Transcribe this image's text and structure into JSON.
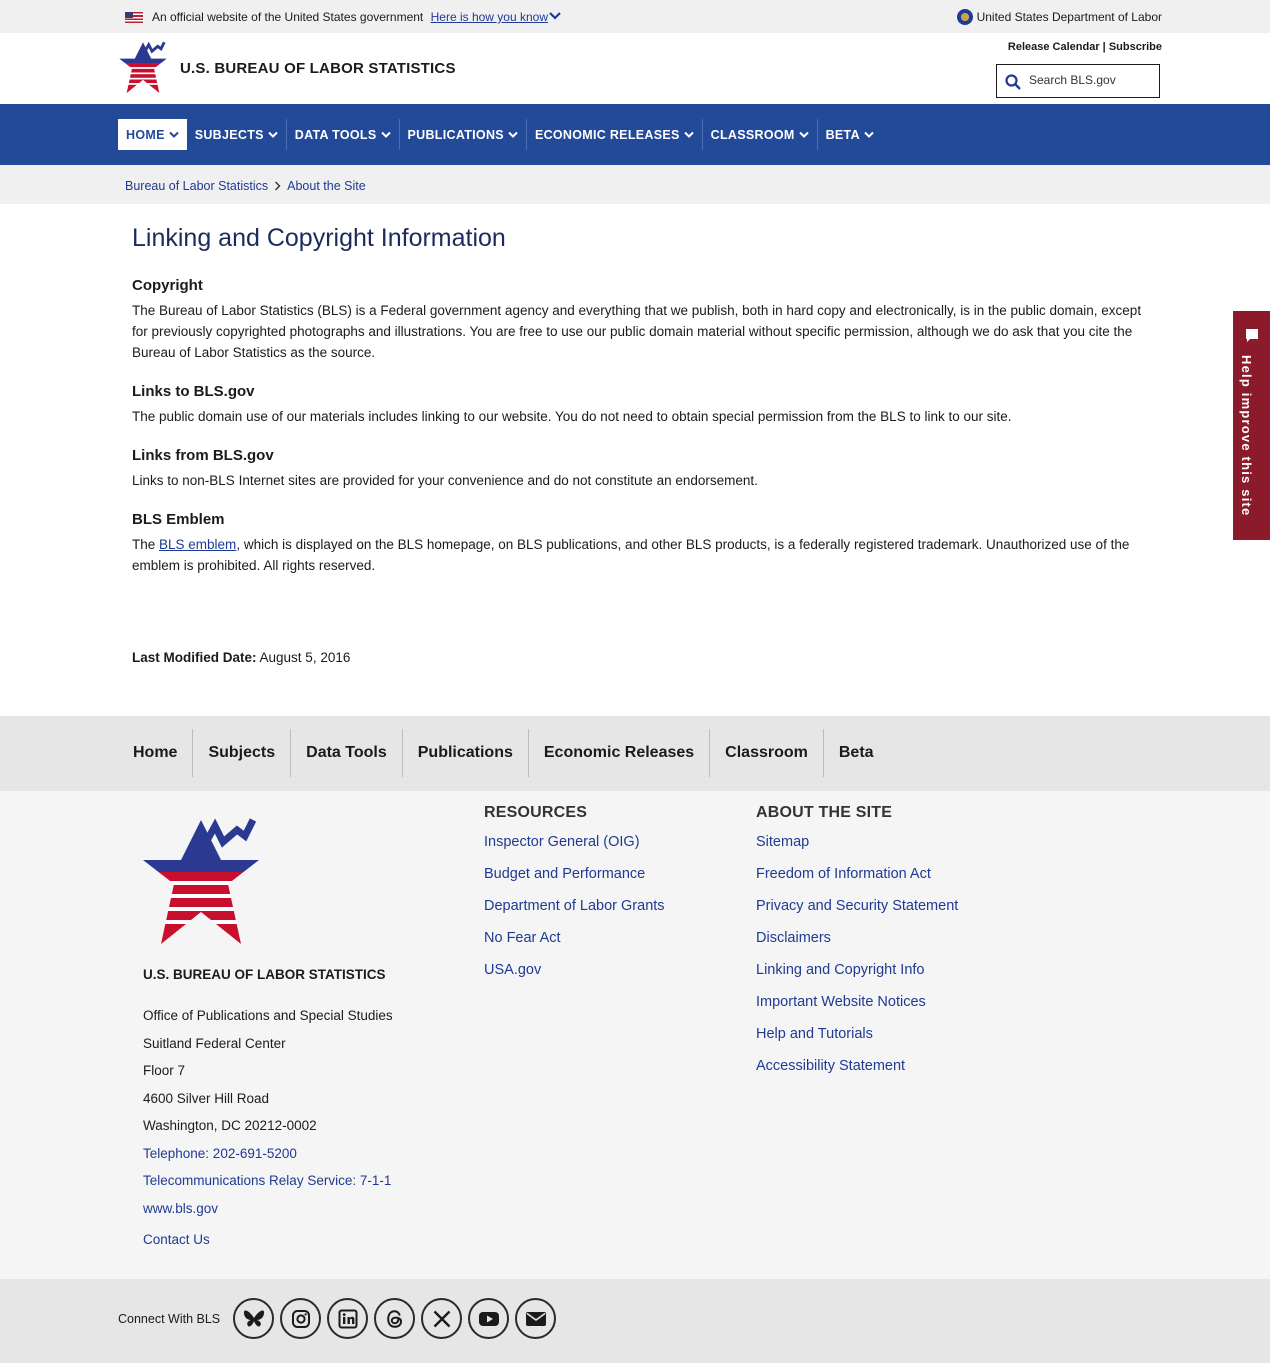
{
  "gov_banner": {
    "official_text": "An official website of the United States government",
    "how_link": "Here is how you know",
    "department": "United States Department of Labor"
  },
  "header": {
    "brand": "U.S. BUREAU OF LABOR STATISTICS",
    "release_calendar": "Release Calendar",
    "separator": "|",
    "subscribe": "Subscribe",
    "search_placeholder": "Search BLS.gov"
  },
  "nav": {
    "items": [
      {
        "label": "HOME"
      },
      {
        "label": "SUBJECTS"
      },
      {
        "label": "DATA TOOLS"
      },
      {
        "label": "PUBLICATIONS"
      },
      {
        "label": "ECONOMIC RELEASES"
      },
      {
        "label": "CLASSROOM"
      },
      {
        "label": "BETA"
      }
    ]
  },
  "breadcrumb": {
    "items": [
      "Bureau of Labor Statistics",
      "About the Site"
    ]
  },
  "content": {
    "title": "Linking and Copyright Information",
    "sections": [
      {
        "heading": "Copyright",
        "body": "The Bureau of Labor Statistics (BLS) is a Federal government agency and everything that we publish, both in hard copy and electronically, is in the public domain, except for previously copyrighted photographs and illustrations. You are free to use our public domain material without specific permission, although we do ask that you cite the Bureau of Labor Statistics as the source."
      },
      {
        "heading": "Links to BLS.gov",
        "body": "The public domain use of our materials includes linking to our website. You do not need to obtain special permission from the BLS to link to our site."
      },
      {
        "heading": "Links from BLS.gov",
        "body": "Links to non-BLS Internet sites are provided for your convenience and do not constitute an endorsement."
      },
      {
        "heading": "BLS Emblem",
        "body_prefix": "The ",
        "body_link": "BLS emblem",
        "body_suffix": ", which is displayed on the BLS homepage, on BLS publications, and other BLS products, is a federally registered trademark. Unauthorized use of the emblem is prohibited. All rights reserved."
      }
    ],
    "last_modified_label": "Last Modified Date:",
    "last_modified_value": "August 5, 2016"
  },
  "feedback": {
    "label": "Help improve this site"
  },
  "footer_nav": {
    "items": [
      "Home",
      "Subjects",
      "Data Tools",
      "Publications",
      "Economic Releases",
      "Classroom",
      "Beta"
    ]
  },
  "footer": {
    "brand": "U.S. BUREAU OF LABOR STATISTICS",
    "address_lines": [
      "Office of Publications and Special Studies",
      "Suitland Federal Center",
      "Floor 7",
      "4600 Silver Hill Road",
      "Washington, DC 20212-0002"
    ],
    "telephone": "Telephone: 202-691-5200",
    "relay": "Telecommunications Relay Service: 7-1-1",
    "website": "www.bls.gov",
    "contact": "Contact Us",
    "resources": {
      "heading": "RESOURCES",
      "links": [
        "Inspector General (OIG)",
        "Budget and Performance",
        "Department of Labor Grants",
        "No Fear Act",
        "USA.gov"
      ]
    },
    "about": {
      "heading": "ABOUT THE SITE",
      "links": [
        "Sitemap",
        "Freedom of Information Act",
        "Privacy and Security Statement",
        "Disclaimers",
        "Linking and Copyright Info",
        "Important Website Notices",
        "Help and Tutorials",
        "Accessibility Statement"
      ]
    }
  },
  "connect": {
    "label": "Connect With BLS",
    "icons": [
      "bluesky-icon",
      "instagram-icon",
      "linkedin-icon",
      "threads-icon",
      "x-icon",
      "youtube-icon",
      "email-icon"
    ]
  },
  "colors": {
    "nav_blue": "#224a99",
    "link_blue": "#1f3a93",
    "feedback_red": "#8b1a2b",
    "star_red": "#c8102e",
    "star_blue": "#2b3990"
  }
}
